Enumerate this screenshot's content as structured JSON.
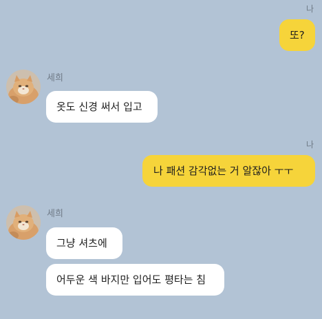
{
  "chat": {
    "messages": [
      {
        "side": "me",
        "sender": "나",
        "text": "또?"
      },
      {
        "side": "friend",
        "sender": "세희",
        "text": "옷도 신경 써서 입고"
      },
      {
        "side": "me",
        "sender": "나",
        "text": "나 패션 감각없는 거 알잖아 ㅜㅜ"
      },
      {
        "side": "friend",
        "sender": "세희",
        "text": "그냥 셔츠에"
      },
      {
        "side": "friend",
        "sender": "",
        "text": "어두운 색 바지만 입어도 평타는 침"
      }
    ]
  },
  "colors": {
    "background": "#b2c3d5",
    "my_bubble": "#f6d43a",
    "their_bubble": "#ffffff"
  },
  "icons": {
    "friend_avatar": "cat-photo-avatar"
  }
}
